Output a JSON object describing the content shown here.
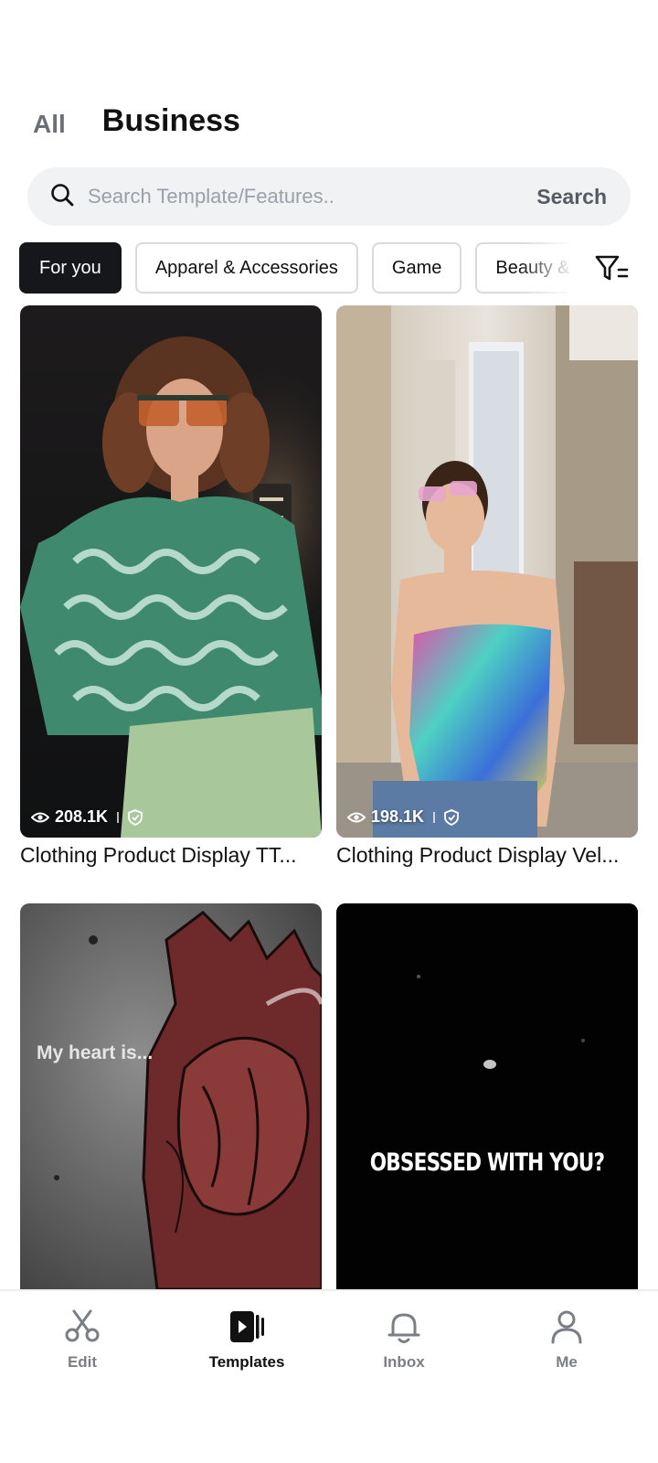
{
  "header": {
    "tabs": [
      {
        "label": "All",
        "active": false
      },
      {
        "label": "Business",
        "active": true
      }
    ]
  },
  "search": {
    "placeholder": "Search Template/Features..",
    "button_label": "Search"
  },
  "categories": [
    {
      "label": "For you",
      "active": true
    },
    {
      "label": "Apparel & Accessories",
      "active": false
    },
    {
      "label": "Game",
      "active": false
    },
    {
      "label": "Beauty &",
      "active": false
    }
  ],
  "templates": [
    {
      "views": "208.1K",
      "title": "Clothing Product Display TT..."
    },
    {
      "views": "198.1K",
      "title": "Clothing Product Display Vel..."
    },
    {
      "overlay_text": "My heart is..."
    },
    {
      "overlay_text": "OBSESSED WITH YOU?"
    }
  ],
  "bottom_nav": [
    {
      "label": "Edit",
      "icon": "scissors-icon",
      "active": false
    },
    {
      "label": "Templates",
      "icon": "templates-icon",
      "active": true
    },
    {
      "label": "Inbox",
      "icon": "bell-icon",
      "active": false
    },
    {
      "label": "Me",
      "icon": "person-icon",
      "active": false
    }
  ],
  "colors": {
    "accent": "#15171b",
    "chip_border": "#d9dadd",
    "search_bg": "#f1f2f4"
  }
}
